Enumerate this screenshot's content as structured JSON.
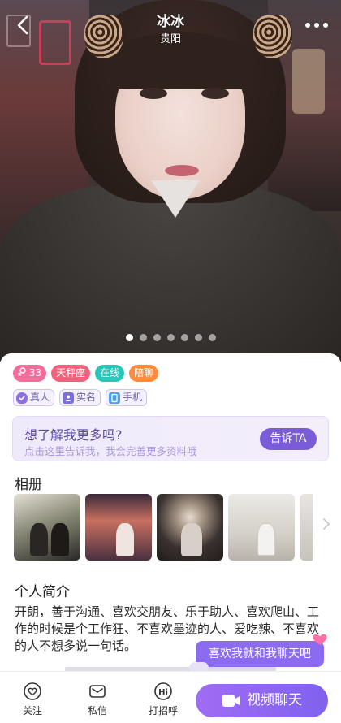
{
  "profile": {
    "nickname": "冰冰",
    "city": "贵阳"
  },
  "photo_pager": {
    "count": 7,
    "active": 1
  },
  "tags": {
    "age": "33",
    "zodiac": "天秤座",
    "status": "在线",
    "service": "陪聊"
  },
  "verifications": {
    "real_person": "真人",
    "real_name": "实名",
    "phone": "手机"
  },
  "promo": {
    "title": "想了解我更多吗?",
    "subtitle": "点击这里告诉我，我会完善更多资料哦",
    "button": "告诉TA"
  },
  "album": {
    "title": "相册"
  },
  "bio": {
    "title": "个人简介",
    "text": "开朗，善于沟通、喜欢交朋友、乐于助人、喜欢爬山、工作的时候是个工作狂、不喜欢墨迹的人、爱吃辣、不喜欢的人不想多说一句话。"
  },
  "chat_prompt": "喜欢我就和我聊天吧",
  "bottom_bar": {
    "follow": "关注",
    "message": "私信",
    "greet": "打招呼",
    "video_call": "视频聊天"
  },
  "colors": {
    "accent": "#7f62ee",
    "tag_age": "#f26d9a",
    "tag_zodiac": "#f2617c",
    "tag_online": "#27c6b8",
    "tag_service": "#ff8a3c"
  }
}
